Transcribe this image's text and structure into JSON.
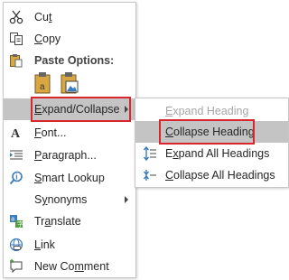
{
  "menu": {
    "items": [
      {
        "label": "Cut",
        "icon": "scissors-icon"
      },
      {
        "label": "Copy",
        "icon": "copy-icon"
      },
      {
        "label": "Paste Options:",
        "icon": "clipboard-icon"
      },
      {
        "label": "Expand/Collapse",
        "icon": "",
        "has_submenu": true,
        "highlighted": true
      },
      {
        "label": "Font...",
        "icon": "font-icon"
      },
      {
        "label": "Paragraph...",
        "icon": "paragraph-icon"
      },
      {
        "label": "Smart Lookup",
        "icon": "smart-lookup-icon"
      },
      {
        "label": "Synonyms",
        "icon": "",
        "has_submenu": true
      },
      {
        "label": "Translate",
        "icon": "translate-icon"
      },
      {
        "label": "Link",
        "icon": "link-icon"
      },
      {
        "label": "New Comment",
        "icon": "new-comment-icon"
      }
    ],
    "paste_options": [
      "paste-keep-formatting-icon",
      "paste-picture-icon"
    ]
  },
  "submenu": {
    "items": [
      {
        "label": "Expand Heading",
        "disabled": true
      },
      {
        "label": "Collapse Heading",
        "highlighted": true
      },
      {
        "label": "Expand All Headings",
        "icon": "expand-all-icon"
      },
      {
        "label": "Collapse All Headings",
        "icon": "collapse-all-icon"
      }
    ]
  },
  "colors": {
    "highlight": "#c4c4c4",
    "annotation_box": "#d9262c",
    "disabled_text": "#a6a6a6"
  }
}
